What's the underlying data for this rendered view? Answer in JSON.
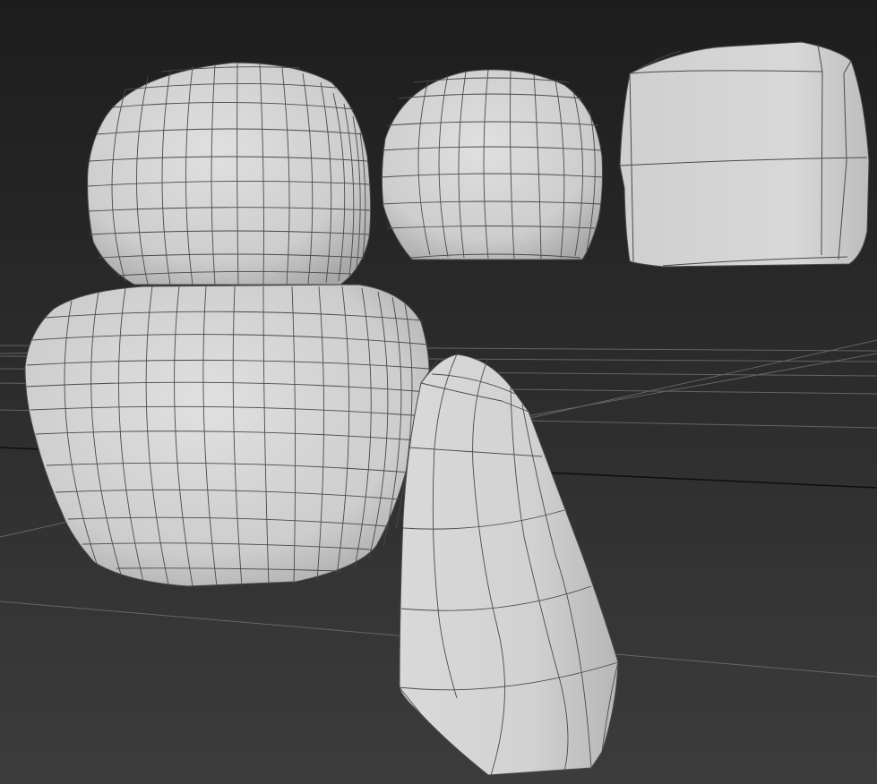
{
  "viewport": {
    "view": "perspective",
    "shading": "default-shading-with-edged-faces",
    "background_colors": [
      "#1d1d1d",
      "#3c3c3c"
    ],
    "grid_color": "#6e6e6e",
    "mesh_fill_color": "#d2d2d2",
    "wire_color": "#4a4a4a"
  },
  "objects": [
    {
      "id": "body-large",
      "shape": "rounded-barrel"
    },
    {
      "id": "head-large",
      "shape": "rounded-barrel"
    },
    {
      "id": "sphere-small",
      "shape": "half-sphere"
    },
    {
      "id": "box-rounded",
      "shape": "rounded-box"
    },
    {
      "id": "arm-tapered",
      "shape": "tapered-cylinder"
    }
  ]
}
